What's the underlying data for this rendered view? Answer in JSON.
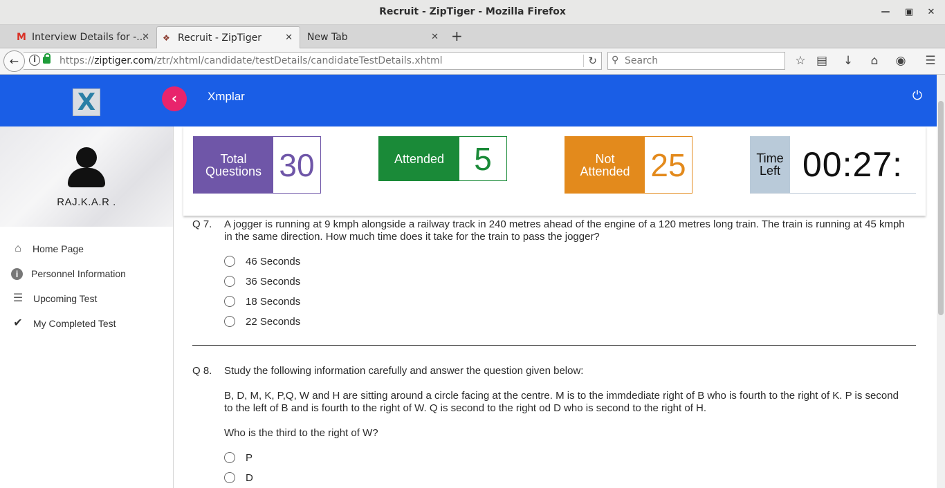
{
  "window": {
    "title": "Recruit - ZipTiger - Mozilla Firefox"
  },
  "tabs": [
    {
      "label": "Interview Details for -...",
      "icon": "gmail-icon"
    },
    {
      "label": "Recruit - ZipTiger",
      "icon": "ziptiger-favicon"
    },
    {
      "label": "New Tab",
      "icon": ""
    }
  ],
  "navbar": {
    "url_prefix": "https://",
    "url_host": "ziptiger.com",
    "url_path": "/ztr/xhtml/candidate/testDetails/candidateTestDetails.xhtml",
    "search_placeholder": "Search"
  },
  "header": {
    "logo_text": "X",
    "brand": "Xmplar"
  },
  "profile": {
    "name": "RAJ.K.A.R ."
  },
  "sidebar": {
    "items": [
      {
        "label": "Home Page",
        "icon": "home-icon"
      },
      {
        "label": "Personnel Information",
        "icon": "info-icon"
      },
      {
        "label": "Upcoming Test",
        "icon": "list-icon"
      },
      {
        "label": "My Completed Test",
        "icon": "check-icon"
      }
    ]
  },
  "stats": {
    "total": {
      "label_line1": "Total",
      "label_line2": "Questions",
      "value": "30"
    },
    "attended": {
      "label": "Attended",
      "value": "5"
    },
    "not_attended": {
      "label_line1": "Not",
      "label_line2": "Attended",
      "value": "25"
    },
    "time_left": {
      "label_line1": "Time",
      "label_line2": "Left",
      "value": "00:27:"
    }
  },
  "questions": [
    {
      "number": "Q 7.",
      "text": "A jogger is running at 9 kmph alongside a railway track in 240 metres ahead of the engine of a 120 metres long train. The train is running at 45 kmph in the same direction. How much time does it take for the train to pass the jogger?",
      "options": [
        "46 Seconds",
        "36 Seconds",
        "18 Seconds",
        "22 Seconds"
      ]
    },
    {
      "number": "Q 8.",
      "intro": "Study the following information carefully and answer the question given below:",
      "passage": "B, D, M, K, P,Q, W and H are sitting around a circle facing at the centre. M is to the immdediate right of B who is fourth to the right of K. P is second to the left of B and is fourth to the right of W. Q is second to the right od D who is second to the right of H.",
      "question": "Who is the third to the right of W?",
      "options": [
        "P",
        "D"
      ]
    }
  ]
}
